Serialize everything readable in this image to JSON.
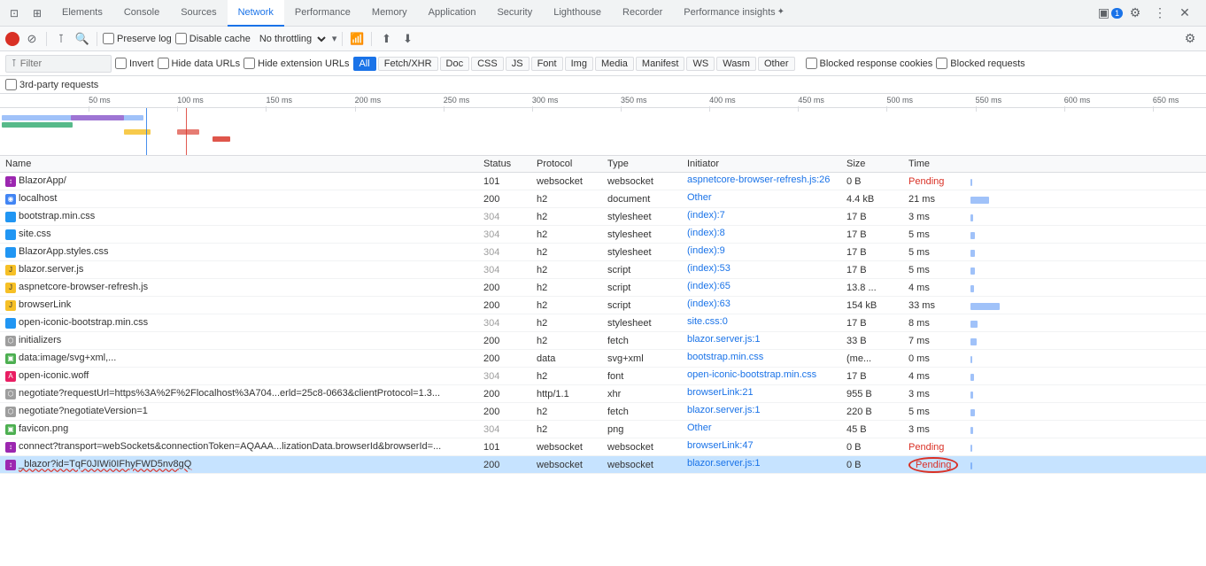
{
  "tabs": [
    {
      "id": "elements",
      "label": "Elements",
      "active": false
    },
    {
      "id": "console",
      "label": "Console",
      "active": false
    },
    {
      "id": "sources",
      "label": "Sources",
      "active": false
    },
    {
      "id": "network",
      "label": "Network",
      "active": true
    },
    {
      "id": "performance",
      "label": "Performance",
      "active": false
    },
    {
      "id": "memory",
      "label": "Memory",
      "active": false
    },
    {
      "id": "application",
      "label": "Application",
      "active": false
    },
    {
      "id": "security",
      "label": "Security",
      "active": false
    },
    {
      "id": "lighthouse",
      "label": "Lighthouse",
      "active": false
    },
    {
      "id": "recorder",
      "label": "Recorder",
      "active": false
    },
    {
      "id": "performance-insights",
      "label": "Performance insights",
      "active": false
    }
  ],
  "toolbar": {
    "preserve_log_label": "Preserve log",
    "disable_cache_label": "Disable cache",
    "throttle_value": "No throttling"
  },
  "filter": {
    "placeholder": "Filter",
    "invert_label": "Invert",
    "hide_data_urls_label": "Hide data URLs",
    "hide_extension_urls_label": "Hide extension URLs",
    "tags": [
      "All",
      "Fetch/XHR",
      "Doc",
      "CSS",
      "JS",
      "Font",
      "Img",
      "Media",
      "Manifest",
      "WS",
      "Wasm",
      "Other"
    ],
    "active_tag": "All",
    "blocked_cookies_label": "Blocked response cookies",
    "blocked_requests_label": "Blocked requests"
  },
  "third_party": {
    "label": "3rd-party requests"
  },
  "timeline": {
    "ticks": [
      "50 ms",
      "100 ms",
      "150 ms",
      "200 ms",
      "250 ms",
      "300 ms",
      "350 ms",
      "400 ms",
      "450 ms",
      "500 ms",
      "550 ms",
      "600 ms",
      "650 ms"
    ]
  },
  "table": {
    "headers": [
      "Name",
      "Status",
      "Protocol",
      "Type",
      "Initiator",
      "Size",
      "Time"
    ],
    "rows": [
      {
        "name": "BlazorApp/",
        "icon": "ws",
        "icon_char": "↕",
        "status": "101",
        "protocol": "websocket",
        "type": "websocket",
        "initiator": "aspnetcore-browser-refresh.js:26",
        "size": "0 B",
        "time": "Pending",
        "selected": false,
        "pending": false
      },
      {
        "name": "localhost",
        "icon": "doc",
        "icon_char": "◉",
        "status": "200",
        "protocol": "h2",
        "type": "document",
        "initiator": "Other",
        "size": "4.4 kB",
        "time": "21 ms",
        "selected": false,
        "pending": false
      },
      {
        "name": "bootstrap.min.css",
        "icon": "css",
        "icon_char": "◧",
        "status": "304",
        "protocol": "h2",
        "type": "stylesheet",
        "initiator": "(index):7",
        "size": "17 B",
        "time": "3 ms",
        "selected": false,
        "pending": false
      },
      {
        "name": "site.css",
        "icon": "css",
        "icon_char": "◧",
        "status": "304",
        "protocol": "h2",
        "type": "stylesheet",
        "initiator": "(index):8",
        "size": "17 B",
        "time": "5 ms",
        "selected": false,
        "pending": false
      },
      {
        "name": "BlazorApp.styles.css",
        "icon": "css",
        "icon_char": "◧",
        "status": "304",
        "protocol": "h2",
        "type": "stylesheet",
        "initiator": "(index):9",
        "size": "17 B",
        "time": "5 ms",
        "selected": false,
        "pending": false
      },
      {
        "name": "blazor.server.js",
        "icon": "js",
        "icon_char": "JS",
        "status": "304",
        "protocol": "h2",
        "type": "script",
        "initiator": "(index):53",
        "size": "17 B",
        "time": "5 ms",
        "selected": false,
        "pending": false
      },
      {
        "name": "aspnetcore-browser-refresh.js",
        "icon": "js",
        "icon_char": "JS",
        "status": "200",
        "protocol": "h2",
        "type": "script",
        "initiator": "(index):65",
        "size": "13.8 ...",
        "time": "4 ms",
        "selected": false,
        "pending": false
      },
      {
        "name": "browserLink",
        "icon": "js",
        "icon_char": "JS",
        "status": "200",
        "protocol": "h2",
        "type": "script",
        "initiator": "(index):63",
        "size": "154 kB",
        "time": "33 ms",
        "selected": false,
        "pending": false
      },
      {
        "name": "open-iconic-bootstrap.min.css",
        "icon": "css",
        "icon_char": "◧",
        "status": "304",
        "protocol": "h2",
        "type": "stylesheet",
        "initiator": "site.css:0",
        "size": "17 B",
        "time": "8 ms",
        "selected": false,
        "pending": false
      },
      {
        "name": "initializers",
        "icon": "other",
        "icon_char": "⬡",
        "status": "200",
        "protocol": "h2",
        "type": "fetch",
        "initiator": "blazor.server.js:1",
        "size": "33 B",
        "time": "7 ms",
        "selected": false,
        "pending": false
      },
      {
        "name": "data:image/svg+xml,...",
        "icon": "img",
        "icon_char": "▣",
        "status": "200",
        "protocol": "data",
        "type": "svg+xml",
        "initiator": "bootstrap.min.css",
        "size": "(me...",
        "time": "0 ms",
        "selected": false,
        "pending": false
      },
      {
        "name": "open-iconic.woff",
        "icon": "font",
        "icon_char": "A",
        "status": "304",
        "protocol": "h2",
        "type": "font",
        "initiator": "open-iconic-bootstrap.min.css",
        "size": "17 B",
        "time": "4 ms",
        "selected": false,
        "pending": false
      },
      {
        "name": "negotiate?requestUrl=https%3A%2F%2Flocalhost%3A704...erld=25c8-0663&clientProtocol=1.3...",
        "icon": "other",
        "icon_char": "⬡",
        "status": "200",
        "protocol": "http/1.1",
        "type": "xhr",
        "initiator": "browserLink:21",
        "size": "955 B",
        "time": "3 ms",
        "selected": false,
        "pending": false
      },
      {
        "name": "negotiate?negotiateVersion=1",
        "icon": "other",
        "icon_char": "⬡",
        "status": "200",
        "protocol": "h2",
        "type": "fetch",
        "initiator": "blazor.server.js:1",
        "size": "220 B",
        "time": "5 ms",
        "selected": false,
        "pending": false
      },
      {
        "name": "favicon.png",
        "icon": "img",
        "icon_char": "▣",
        "status": "304",
        "protocol": "h2",
        "type": "png",
        "initiator": "Other",
        "size": "45 B",
        "time": "3 ms",
        "selected": false,
        "pending": false
      },
      {
        "name": "connect?transport=webSockets&connectionToken=AQAAA...lizationData.browserId&browserId=...",
        "icon": "ws",
        "icon_char": "↕",
        "status": "101",
        "protocol": "websocket",
        "type": "websocket",
        "initiator": "browserLink:47",
        "size": "0 B",
        "time": "Pending",
        "selected": false,
        "pending": false
      },
      {
        "name": "_blazor?id=TqF0JIWi0IFhyFWD5nv8gQ",
        "icon": "ws",
        "icon_char": "↕",
        "status": "200",
        "protocol": "websocket",
        "type": "websocket",
        "initiator": "blazor.server.js:1",
        "size": "0 B",
        "time": "Pending",
        "selected": true,
        "pending": true,
        "red_underline": true
      }
    ]
  },
  "icons": {
    "record": "⏺",
    "stop": "⊘",
    "clear": "🚫",
    "search": "🔍",
    "filter": "⊺",
    "import": "⬆",
    "export": "⬇",
    "settings": "⚙",
    "more": "⋮",
    "close": "✕",
    "dock": "▣",
    "undock": "⊡",
    "wifi": "📶",
    "badge_count": "1"
  },
  "colors": {
    "accent": "#1a73e8",
    "danger": "#d93025",
    "bg": "#f8f9fa",
    "border": "#dadce0",
    "selected_row": "#c6e3ff",
    "pending_text": "#d93025"
  }
}
